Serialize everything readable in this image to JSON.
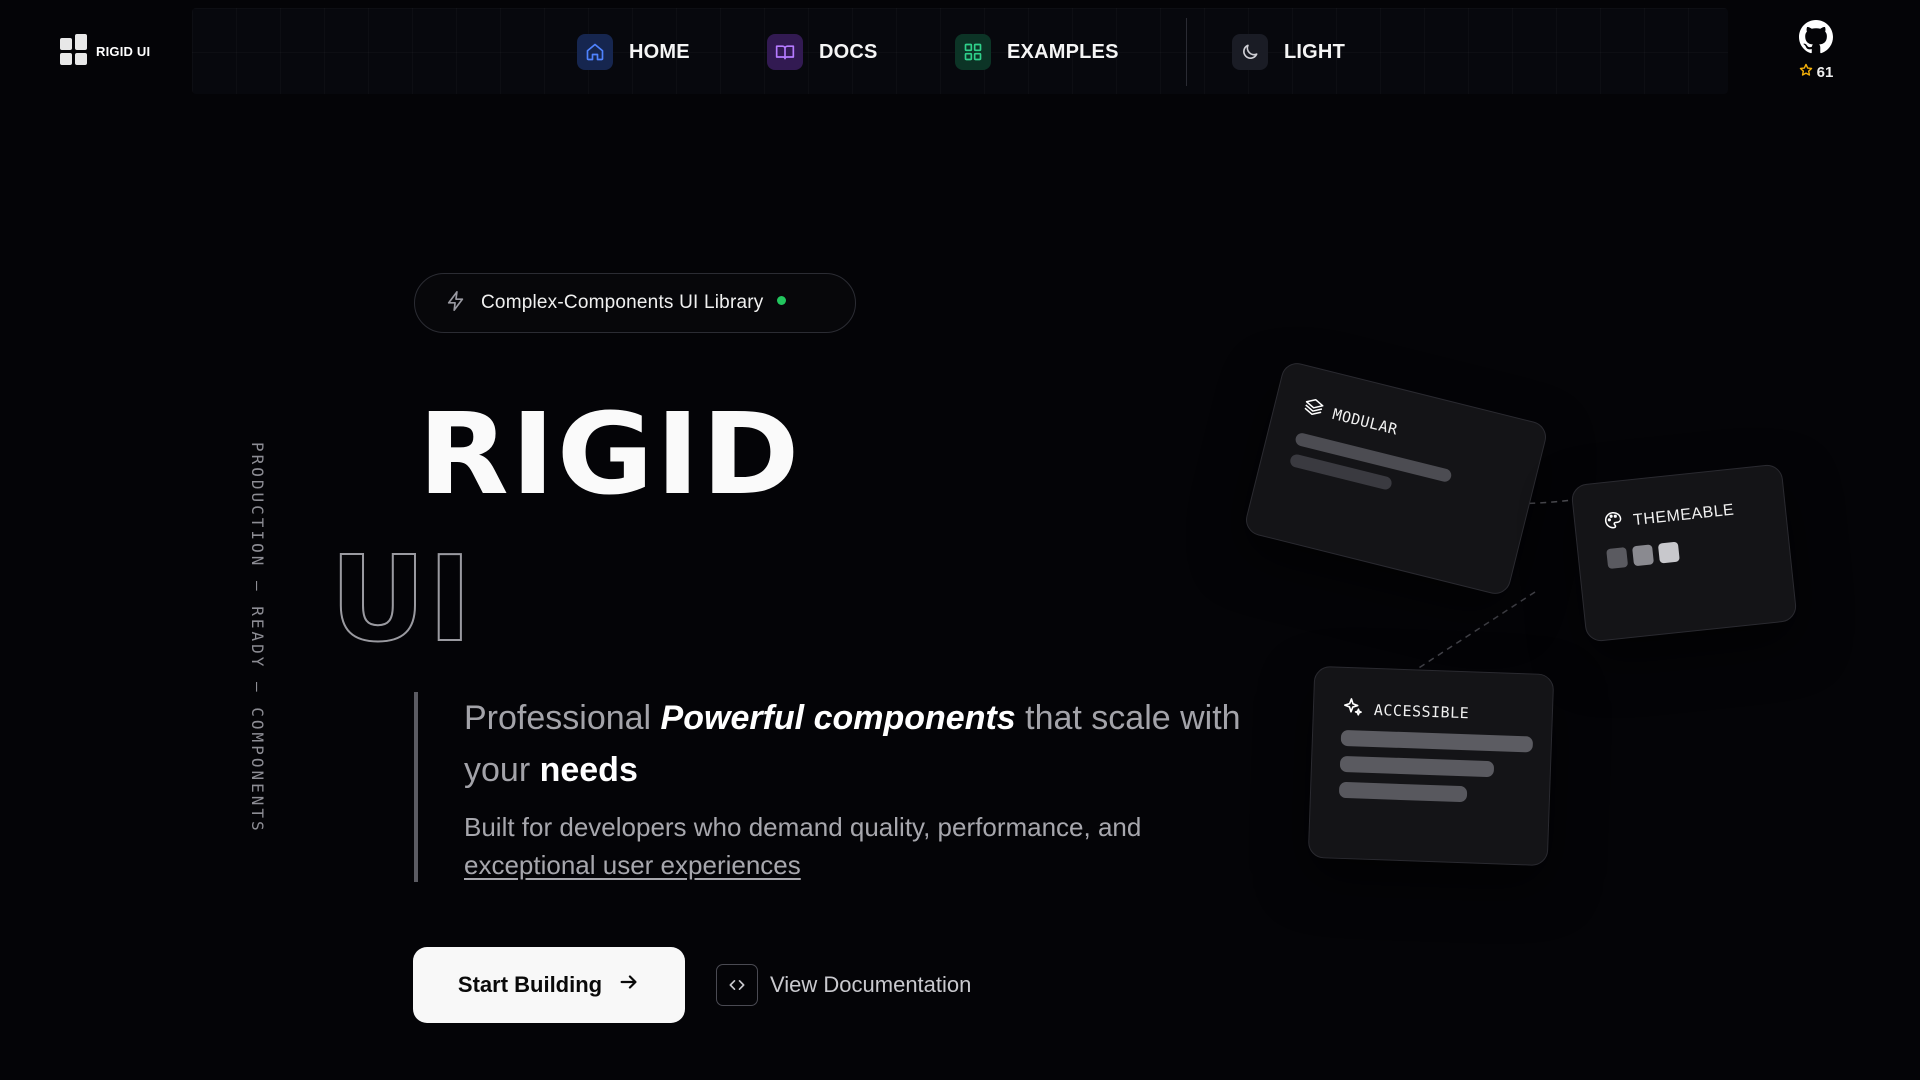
{
  "brand": {
    "name": "RIGID UI"
  },
  "nav": {
    "items": [
      {
        "label": "HOME",
        "icon": "home-icon",
        "accent": "#1e3a8a"
      },
      {
        "label": "DOCS",
        "icon": "book-icon",
        "accent": "#4c1d95"
      },
      {
        "label": "EXAMPLES",
        "icon": "grid-icon",
        "accent": "#064e3b"
      }
    ],
    "theme_toggle": {
      "label": "LIGHT",
      "icon": "moon-icon"
    }
  },
  "github": {
    "icon": "github-icon",
    "stars": "61"
  },
  "hero": {
    "badge": "Complex-Components UI Library",
    "side_text": "PRODUCTION — READY — COMPONENTS",
    "title_main": "RIGID",
    "title_outline": "UI",
    "tagline": {
      "prefix": "Professional ",
      "emphasis": "Powerful components",
      "middle": " that scale with your ",
      "strong": "needs"
    },
    "description": {
      "text": "Built for developers who demand quality, performance, and ",
      "underlined": "exceptional user experiences"
    },
    "primary_cta": "Start Building",
    "secondary_cta": "View Documentation"
  },
  "cards": {
    "modular": "MODULAR",
    "themeable": "THEMEABLE",
    "accessible": "ACCESSIBLE"
  },
  "colors": {
    "background": "#040407",
    "status_dot": "#22c55e",
    "star": "#f5b10a"
  }
}
